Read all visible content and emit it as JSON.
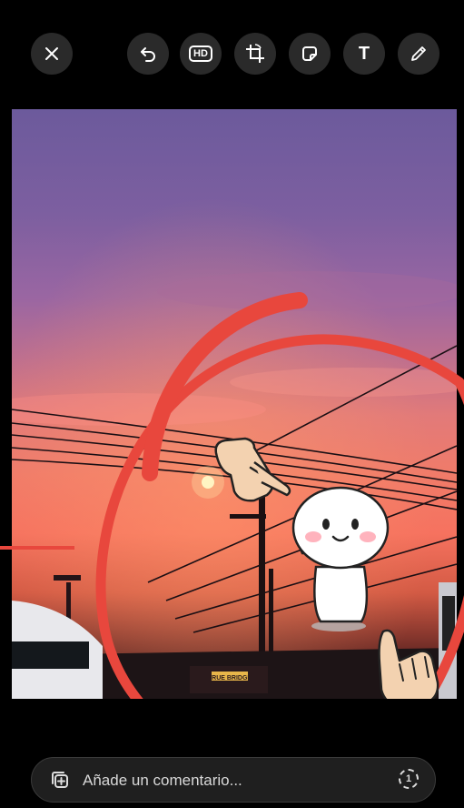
{
  "toolbar": {
    "close_icon": "close-icon",
    "undo_icon": "undo-icon",
    "hd_label": "HD",
    "crop_icon": "crop-rotate-icon",
    "sticker_icon": "sticker-icon",
    "text_label": "T",
    "draw_icon": "pencil-icon"
  },
  "photo": {
    "bus_sign": "TRUE BRIDGE"
  },
  "composer": {
    "placeholder": "Añade un comentario...",
    "view_once_label": "1"
  },
  "colors": {
    "annotation_red": "#e8473d",
    "toolbar_button_bg": "#2a2a2a"
  }
}
